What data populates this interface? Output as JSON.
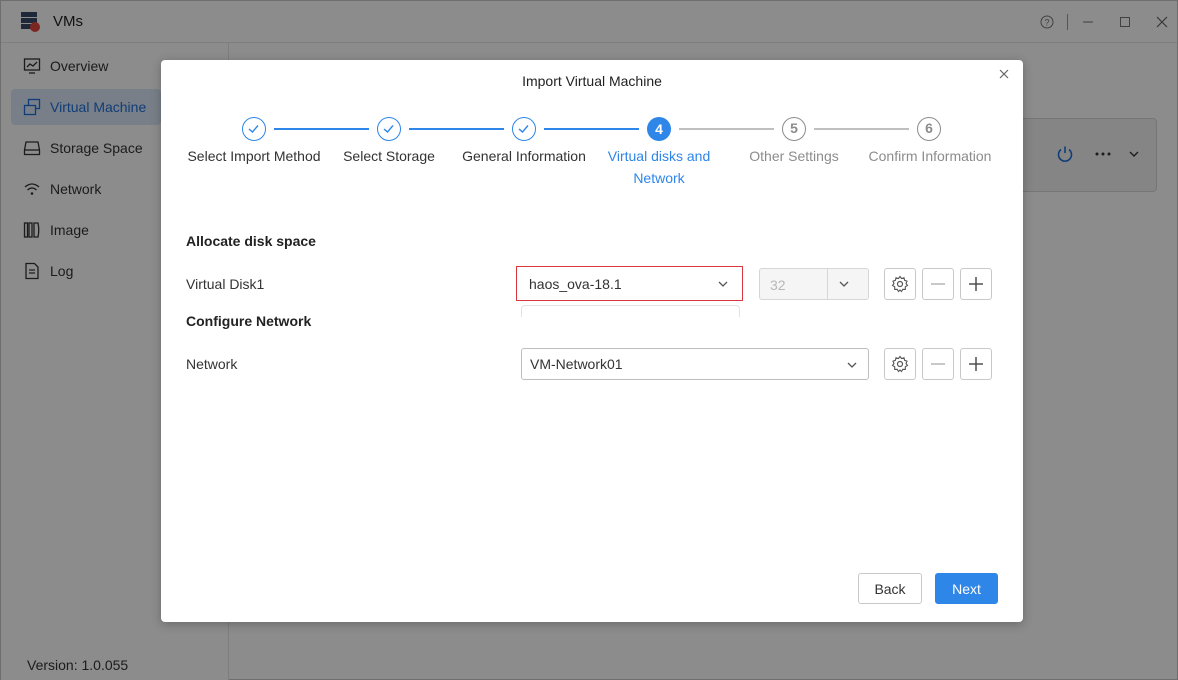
{
  "window": {
    "app_title": "VMs",
    "help_icon": "help-icon",
    "minimize_icon": "minimize-icon",
    "maximize_icon": "maximize-icon",
    "close_icon": "close-icon"
  },
  "sidebar": {
    "items": [
      {
        "label": "Overview",
        "icon": "monitor-chart-icon",
        "active": false
      },
      {
        "label": "Virtual Machine",
        "icon": "virtual-machine-icon",
        "active": true
      },
      {
        "label": "Storage Space",
        "icon": "drive-icon",
        "active": false
      },
      {
        "label": "Network",
        "icon": "wifi-icon",
        "active": false
      },
      {
        "label": "Image",
        "icon": "image-disc-icon",
        "active": false
      },
      {
        "label": "Log",
        "icon": "log-file-icon",
        "active": false
      }
    ],
    "version": "Version: 1.0.055"
  },
  "modal": {
    "title": "Import Virtual Machine",
    "steps": [
      {
        "number": "1",
        "label": "Select Import Method",
        "state": "done"
      },
      {
        "number": "2",
        "label": "Select Storage",
        "state": "done"
      },
      {
        "number": "3",
        "label": "General Information",
        "state": "done"
      },
      {
        "number": "4",
        "label_line1": "Virtual disks and",
        "label_line2": "Network",
        "state": "current"
      },
      {
        "number": "5",
        "label": "Other Settings",
        "state": "todo"
      },
      {
        "number": "6",
        "label": "Confirm Information",
        "state": "todo"
      }
    ],
    "disk_section": {
      "title": "Allocate disk space",
      "row_label": "Virtual Disk1",
      "disk_value": "haos_ova-18.1",
      "size_value": "32"
    },
    "network_section": {
      "title": "Configure Network",
      "row_label": "Network",
      "network_value": "VM-Network01"
    },
    "buttons": {
      "back": "Back",
      "next": "Next"
    }
  },
  "colors": {
    "accent": "#2e86e8",
    "highlight_border": "#d9363e",
    "inactive_step": "#8c8c8c"
  }
}
